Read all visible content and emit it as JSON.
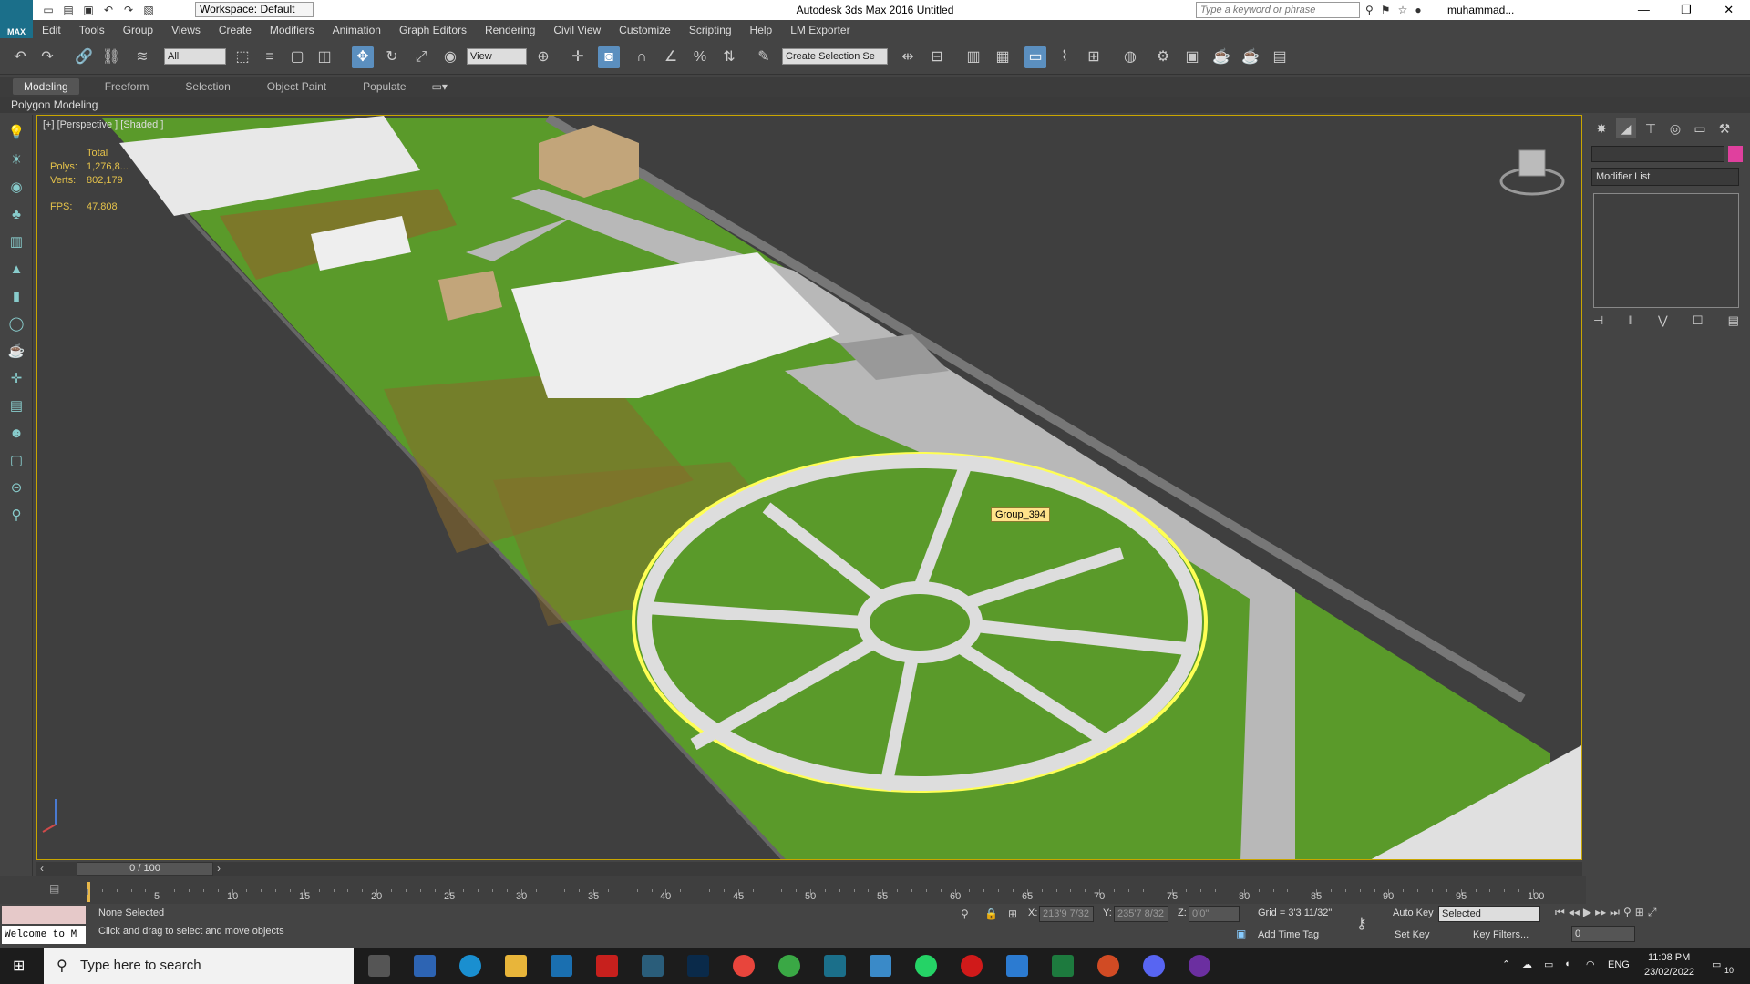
{
  "titlebar": {
    "workspace": "Workspace: Default",
    "title": "Autodesk 3ds Max 2016    Untitled",
    "search_placeholder": "Type a keyword or phrase",
    "user": "muhammad...",
    "logo_label": "MAX"
  },
  "menu": [
    "Edit",
    "Tools",
    "Group",
    "Views",
    "Create",
    "Modifiers",
    "Animation",
    "Graph Editors",
    "Rendering",
    "Civil View",
    "Customize",
    "Scripting",
    "Help",
    "LM Exporter"
  ],
  "toolbar": {
    "filter": "All",
    "refcoord": "View",
    "selection_set": "Create Selection Se"
  },
  "ribbon": {
    "tabs": [
      "Modeling",
      "Freeform",
      "Selection",
      "Object Paint",
      "Populate"
    ],
    "active_tab": "Modeling",
    "panel_label": "Polygon Modeling"
  },
  "viewport": {
    "label": "[+] [Perspective ] [Shaded ]",
    "stats": {
      "total_label": "Total",
      "polys_label": "Polys:",
      "polys_value": "1,276,8...",
      "verts_label": "Verts:",
      "verts_value": "802,179",
      "fps_label": "FPS:",
      "fps_value": "47.808"
    },
    "tooltip": "Group_394"
  },
  "command_panel": {
    "modifier_list": "Modifier List",
    "swatch_color": "#e0409e"
  },
  "timeline": {
    "frame": "0 / 100",
    "ticks": [
      "5",
      "10",
      "15",
      "20",
      "25",
      "30",
      "35",
      "40",
      "45",
      "50",
      "55",
      "60",
      "65",
      "70",
      "75",
      "80",
      "85",
      "90",
      "95",
      "100"
    ]
  },
  "status": {
    "selection": "None Selected",
    "prompt": "Click and drag to select and move objects",
    "welcome": "Welcome to M",
    "x_label": "X:",
    "x_value": "213'9 7/32",
    "y_label": "Y:",
    "y_value": "235'7 8/32",
    "z_label": "Z:",
    "z_value": "0'0\"",
    "grid": "Grid = 3'3 11/32\"",
    "add_time_tag": "Add Time Tag",
    "auto_key": "Auto Key",
    "set_key": "Set Key",
    "key_mode": "Selected",
    "key_filters": "Key Filters...",
    "frame_field": "0"
  },
  "taskbar": {
    "search_placeholder": "Type here to search",
    "time": "11:08 PM",
    "date": "23/02/2022",
    "lang": "ENG",
    "notifications": "10"
  }
}
